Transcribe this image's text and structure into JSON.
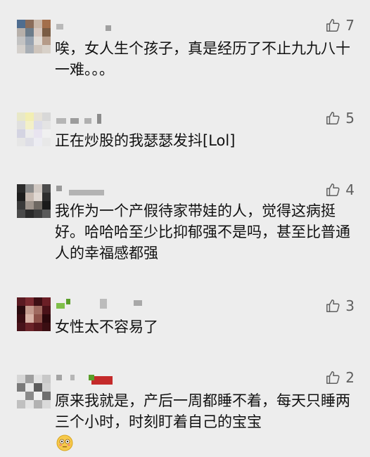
{
  "comments": [
    {
      "text": "唉，女人生个孩子，真是经历了不止九九八十一难。。。",
      "likes": "7"
    },
    {
      "text": "正在炒股的我瑟瑟发抖[Lol]",
      "likes": "5"
    },
    {
      "text": "我作为一个产假待家带娃的人，觉得这病挺好。哈哈哈至少比抑郁强不是吗，甚至比普通人的幸福感都强",
      "likes": "4"
    },
    {
      "text": "女性太不容易了",
      "likes": "3"
    },
    {
      "text": "原来我就是，产后一周都睡不着，每天只睡两三个小时，时刻盯着自己的宝宝",
      "likes": "2",
      "emoji": "flushed-face-emoji"
    }
  ],
  "icons": {
    "like": "thumbs-up-icon"
  },
  "colors": {
    "background": "#ededed",
    "text": "#111111",
    "like": "#5f5f5f"
  }
}
